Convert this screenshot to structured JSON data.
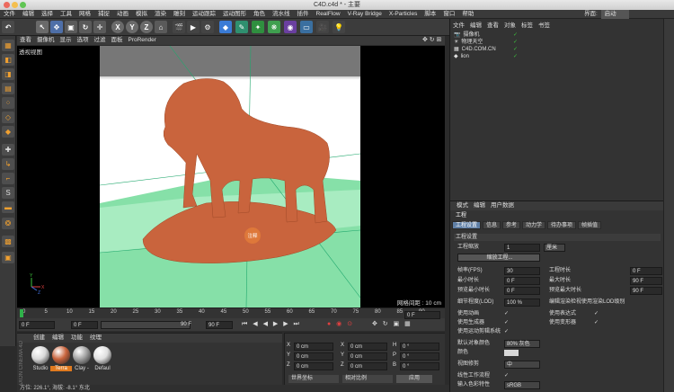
{
  "window": {
    "title": "C4D.c4d * - 主要"
  },
  "menubar": [
    "文件",
    "编辑",
    "选择",
    "工具",
    "网格",
    "捕捉",
    "动画",
    "模拟",
    "渲染",
    "雕刻",
    "运动跟踪",
    "运动图形",
    "角色",
    "流水线",
    "插件",
    "RealFlow",
    "V-Ray Bridge",
    "X-Particles",
    "脚本",
    "窗口",
    "帮助"
  ],
  "layout": {
    "label": "界面:",
    "value": "启动"
  },
  "toolbar": {
    "x": "X",
    "y": "Y",
    "z": "Z"
  },
  "viewport": {
    "menu": [
      "查看",
      "摄像机",
      "显示",
      "选项",
      "过滤",
      "面板",
      "ProRender"
    ],
    "title": "透视视图",
    "grid_status": "网格间距 : 10 cm",
    "annotation": "注释",
    "axis_y": "Y",
    "axis_x": "X",
    "axis_z": "Z"
  },
  "timeline": {
    "ticks": [
      "0",
      "5",
      "10",
      "15",
      "20",
      "25",
      "30",
      "35",
      "40",
      "45",
      "50",
      "55",
      "60",
      "65",
      "70",
      "75",
      "80",
      "85",
      "90"
    ],
    "current_frame": "0 F",
    "start": "0 F",
    "end": "90 F",
    "end2": "90 F",
    "right_field": "0 F"
  },
  "material_panel": {
    "menu": [
      "创建",
      "编辑",
      "功能",
      "纹理"
    ],
    "materials": [
      {
        "name": "Studio",
        "color": "#d9d9d9"
      },
      {
        "name": "Terra",
        "color": "#c9643d"
      },
      {
        "name": "Clay -",
        "color": "#a0a0a0"
      },
      {
        "name": "Defaul",
        "color": "#e0e0e0"
      }
    ],
    "watermark": "MAXON CINEMA 4D"
  },
  "coord_panel": {
    "rows": [
      {
        "a": "X",
        "av": "0 cm",
        "b": "X",
        "bv": "0 cm",
        "c": "H",
        "cv": "0 °"
      },
      {
        "a": "Y",
        "av": "0 cm",
        "b": "Y",
        "bv": "0 cm",
        "c": "P",
        "cv": "0 °"
      },
      {
        "a": "Z",
        "av": "0 cm",
        "b": "Z",
        "bv": "0 cm",
        "c": "B",
        "cv": "0 °"
      }
    ],
    "world": "世界坐标",
    "scale": "相对比例",
    "apply": "应用"
  },
  "statusbar": {
    "text": "方位: 226.1°, 海拔: -8.1° 东北"
  },
  "object_manager": {
    "menu": [
      "文件",
      "编辑",
      "查看",
      "对象",
      "标签",
      "书签"
    ],
    "objects": [
      {
        "name": "摄像机"
      },
      {
        "name": "物理天空"
      },
      {
        "name": "C4D.COM.CN"
      },
      {
        "name": "lion"
      }
    ]
  },
  "attributes": {
    "menu": [
      "模式",
      "编辑",
      "用户数据"
    ],
    "section": "工程",
    "tabs": [
      "工程设置",
      "信息",
      "参考",
      "动力学",
      "待办事项",
      "帧插值"
    ],
    "group_title": "工程设置",
    "scale_label": "工程缩放",
    "scale_value": "1",
    "scale_unit": "厘米",
    "scale_button": "缩放工程...",
    "fps_label": "帧率(FPS)",
    "fps_value": "30",
    "proj_len_label": "工程时长",
    "proj_len_value": "0 F",
    "min_label": "最小时长",
    "min_value": "0 F",
    "max_label": "最大时长",
    "max_value": "90 F",
    "pmin_label": "预览最小时长",
    "pmin_value": "0 F",
    "pmax_label": "预览最大时长",
    "pmax_value": "90 F",
    "lod_label": "细节程度(LOD)",
    "lod_value": "100 %",
    "lod_render_label": "编辑渲染检视使用渲染LOD级别",
    "anim_label": "使用动画",
    "expr_label": "使用表达式",
    "gen_label": "使用生成器",
    "deform_label": "使用变形器",
    "motion_label": "使用运动剪辑系统",
    "objcolor_label": "默认对象颜色",
    "objcolor_value": "80% 灰色",
    "color_label": "颜色",
    "viewcorr_label": "视图修剪",
    "viewcorr_value": "中",
    "linear_label": "线性工作流程",
    "input_label": "输入色彩特性",
    "input_value": "sRGB"
  },
  "colors": {
    "accent": "#5f7fa6",
    "terra": "#c9643d",
    "ground": "#86e0a8"
  }
}
